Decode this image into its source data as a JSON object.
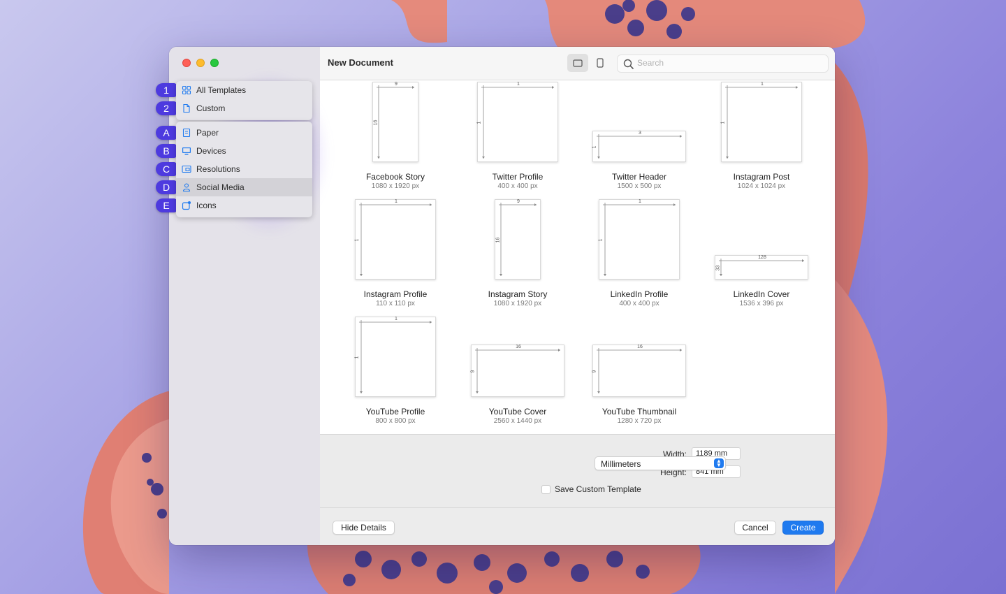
{
  "window": {
    "title": "New Document",
    "search_placeholder": "Search"
  },
  "sidebar_menu": {
    "groups": [
      [
        {
          "badge": "1",
          "label": "All Templates",
          "icon": "grid-icon"
        },
        {
          "badge": "2",
          "label": "Custom",
          "icon": "document-icon"
        }
      ],
      [
        {
          "badge": "A",
          "label": "Paper",
          "icon": "paper-icon"
        },
        {
          "badge": "B",
          "label": "Devices",
          "icon": "monitor-icon"
        },
        {
          "badge": "C",
          "label": "Resolutions",
          "icon": "resolution-icon"
        },
        {
          "badge": "D",
          "label": "Social Media",
          "icon": "person-icon",
          "selected": true
        },
        {
          "badge": "E",
          "label": "Icons",
          "icon": "app-icon"
        }
      ]
    ]
  },
  "templates": [
    {
      "name": "Facebook Story",
      "size": "1080 x 1920 px",
      "w_label": "9",
      "h_label": "16"
    },
    {
      "name": "Twitter Profile",
      "size": "400 x 400 px",
      "w_label": "1",
      "h_label": "1"
    },
    {
      "name": "Twitter Header",
      "size": "1500 x 500 px",
      "w_label": "3",
      "h_label": "1"
    },
    {
      "name": "Instagram Post",
      "size": "1024 x 1024 px",
      "w_label": "1",
      "h_label": "1"
    },
    {
      "name": "Instagram Profile",
      "size": "110 x 110 px",
      "w_label": "1",
      "h_label": "1"
    },
    {
      "name": "Instagram Story",
      "size": "1080 x 1920 px",
      "w_label": "9",
      "h_label": "16"
    },
    {
      "name": "LinkedIn Profile",
      "size": "400 x 400 px",
      "w_label": "1",
      "h_label": "1"
    },
    {
      "name": "LinkedIn Cover",
      "size": "1536 x 396 px",
      "w_label": "128",
      "h_label": "33"
    },
    {
      "name": "YouTube Profile",
      "size": "800 x 800 px",
      "w_label": "1",
      "h_label": "1"
    },
    {
      "name": "YouTube Cover",
      "size": "2560 x 1440 px",
      "w_label": "16",
      "h_label": "9"
    },
    {
      "name": "YouTube Thumbnail",
      "size": "1280 x 720 px",
      "w_label": "16",
      "h_label": "9"
    }
  ],
  "details": {
    "width_label": "Width:",
    "width_value": "1189 mm",
    "height_label": "Height:",
    "height_value": "841 mm",
    "units": "Millimeters",
    "save_custom_label": "Save Custom Template"
  },
  "footer": {
    "hide_details": "Hide Details",
    "cancel": "Cancel",
    "create": "Create"
  },
  "colors": {
    "accent": "#1f7aef",
    "badge": "#4d3adf"
  }
}
